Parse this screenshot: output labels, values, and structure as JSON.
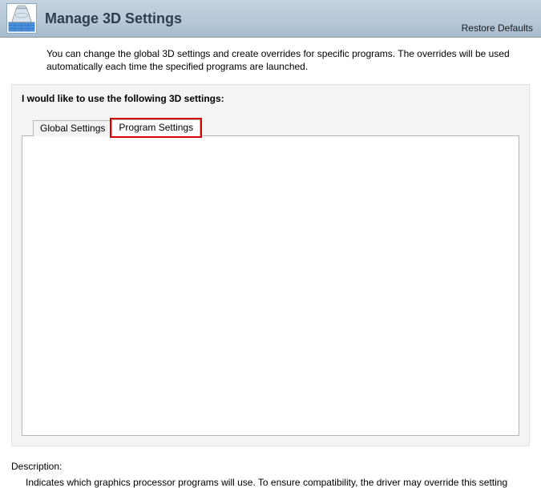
{
  "header": {
    "title": "Manage 3D Settings",
    "restore": "Restore Defaults"
  },
  "intro": "You can change the global 3D settings and create overrides for specific programs. The overrides will be used automatically each time the specified programs are launched.",
  "panel": {
    "title": "I would like to use the following 3D settings:",
    "tabs": {
      "global": "Global Settings",
      "program": "Program Settings"
    }
  },
  "description": {
    "label": "Description:",
    "text": "Indicates which graphics processor programs will use. To ensure compatibility, the driver may override this setting"
  }
}
